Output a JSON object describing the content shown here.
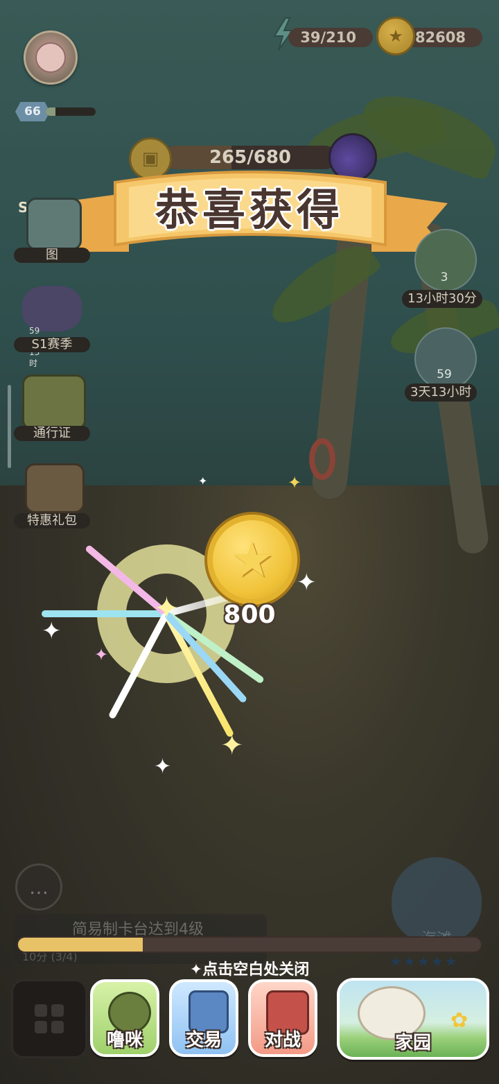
{
  "top_bar": {
    "level": "66",
    "level_progress": 0.2,
    "energy": "39/210",
    "coins": "82608",
    "collection_progress": "265/680",
    "collection_fraction": 0.39
  },
  "banner": {
    "title": "恭喜获得"
  },
  "left_menu": {
    "s1_tag": "S1",
    "items": [
      {
        "label": "图"
      },
      {
        "label": "S1赛季",
        "timer": "59天13时"
      },
      {
        "label": "通行证"
      },
      {
        "label": "特惠礼包"
      }
    ]
  },
  "right_menu": {
    "items": [
      {
        "count": "3",
        "label": "13小时30分"
      },
      {
        "count": "59",
        "label": "3天13小时"
      }
    ]
  },
  "reward": {
    "amount": "800"
  },
  "task": {
    "title": "简易制卡台达到4级",
    "sub": "10分 (3/4)",
    "progress": 0.27
  },
  "close_hint": "点击空白处关闭",
  "area": {
    "name": "海滩",
    "stars": "★★★★★"
  },
  "bottom_nav": {
    "pet": "噜咪",
    "trade": "交易",
    "battle": "对战",
    "home": "家园"
  },
  "colors": {
    "gold": "#f0c238",
    "banner": "#f6c76a",
    "xp": "#e8c267"
  },
  "icons": [
    "energy-icon",
    "coin-icon",
    "card-icon",
    "fruit-icon",
    "chat-icon",
    "grid-icon"
  ]
}
